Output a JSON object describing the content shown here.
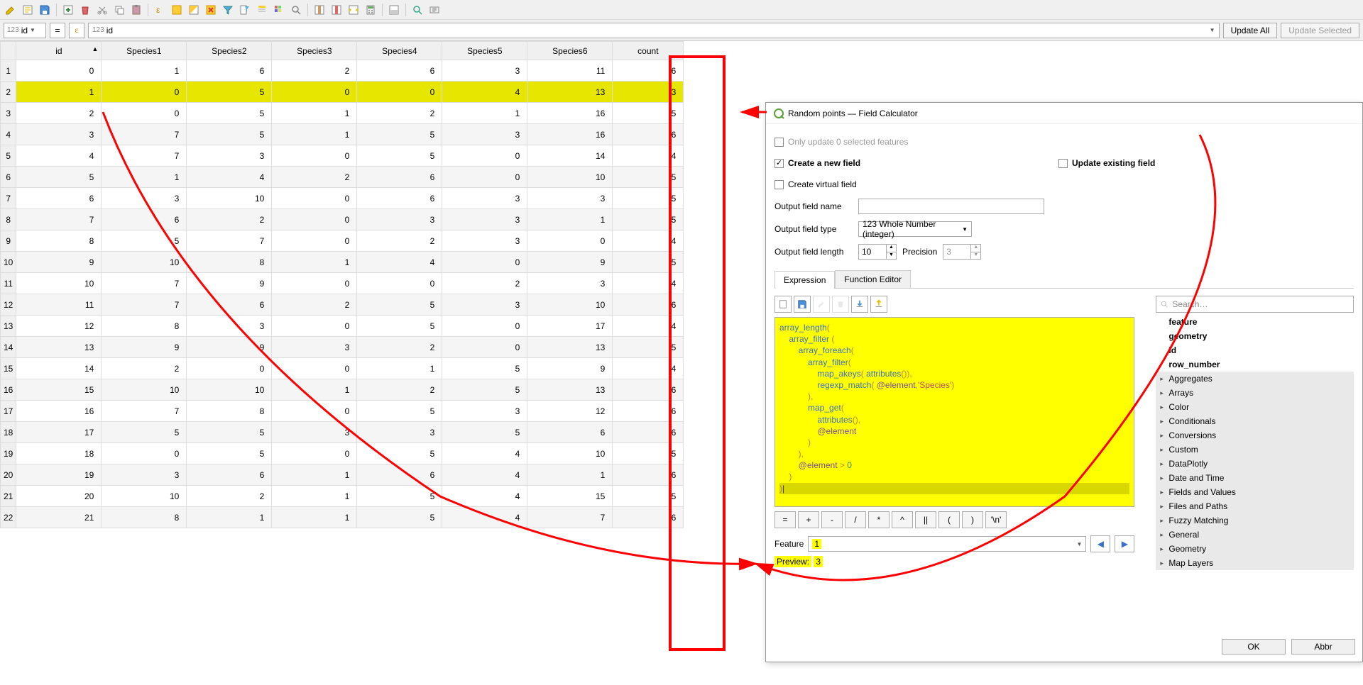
{
  "toolbar_icons": [
    "pencil",
    "edit-form",
    "save",
    "add-feature",
    "delete",
    "cut",
    "copy",
    "paste",
    "expression",
    "select-all",
    "invert",
    "deselect",
    "filter",
    "filter-form",
    "move-top",
    "dock",
    "zoom",
    "pan",
    "highlight",
    "layout",
    "calc",
    "zoom-to",
    "field-calc-open"
  ],
  "formula": {
    "field_type": "123",
    "field_name": "id",
    "eq": "=",
    "eps": "ε",
    "expr_field": "123",
    "expr_name": "id",
    "update_all": "Update All",
    "update_sel": "Update Selected"
  },
  "columns": [
    "id",
    "Species1",
    "Species2",
    "Species3",
    "Species4",
    "Species5",
    "Species6",
    "count"
  ],
  "rows": [
    {
      "n": 1,
      "hl": false,
      "v": [
        0,
        1,
        6,
        2,
        6,
        3,
        11,
        6
      ]
    },
    {
      "n": 2,
      "hl": true,
      "v": [
        1,
        0,
        5,
        0,
        0,
        4,
        13,
        3
      ]
    },
    {
      "n": 3,
      "hl": false,
      "v": [
        2,
        0,
        5,
        1,
        2,
        1,
        16,
        5
      ]
    },
    {
      "n": 4,
      "hl": false,
      "v": [
        3,
        7,
        5,
        1,
        5,
        3,
        16,
        6
      ]
    },
    {
      "n": 5,
      "hl": false,
      "v": [
        4,
        7,
        3,
        0,
        5,
        0,
        14,
        4
      ]
    },
    {
      "n": 6,
      "hl": false,
      "v": [
        5,
        1,
        4,
        2,
        6,
        0,
        10,
        5
      ]
    },
    {
      "n": 7,
      "hl": false,
      "v": [
        6,
        3,
        10,
        0,
        6,
        3,
        3,
        5
      ]
    },
    {
      "n": 8,
      "hl": false,
      "v": [
        7,
        6,
        2,
        0,
        3,
        3,
        1,
        5
      ]
    },
    {
      "n": 9,
      "hl": false,
      "v": [
        8,
        5,
        7,
        0,
        2,
        3,
        0,
        4
      ]
    },
    {
      "n": 10,
      "hl": false,
      "v": [
        9,
        10,
        8,
        1,
        4,
        0,
        9,
        5
      ]
    },
    {
      "n": 11,
      "hl": false,
      "v": [
        10,
        7,
        9,
        0,
        0,
        2,
        3,
        4
      ]
    },
    {
      "n": 12,
      "hl": false,
      "v": [
        11,
        7,
        6,
        2,
        5,
        3,
        10,
        6
      ]
    },
    {
      "n": 13,
      "hl": false,
      "v": [
        12,
        8,
        3,
        0,
        5,
        0,
        17,
        4
      ]
    },
    {
      "n": 14,
      "hl": false,
      "v": [
        13,
        9,
        9,
        3,
        2,
        0,
        13,
        5
      ]
    },
    {
      "n": 15,
      "hl": false,
      "v": [
        14,
        2,
        0,
        0,
        1,
        5,
        9,
        4
      ]
    },
    {
      "n": 16,
      "hl": false,
      "v": [
        15,
        10,
        10,
        1,
        2,
        5,
        13,
        6
      ]
    },
    {
      "n": 17,
      "hl": false,
      "v": [
        16,
        7,
        8,
        0,
        5,
        3,
        12,
        6
      ]
    },
    {
      "n": 18,
      "hl": false,
      "v": [
        17,
        5,
        5,
        3,
        3,
        5,
        6,
        6
      ]
    },
    {
      "n": 19,
      "hl": false,
      "v": [
        18,
        0,
        5,
        0,
        5,
        4,
        10,
        5
      ]
    },
    {
      "n": 20,
      "hl": false,
      "v": [
        19,
        3,
        6,
        1,
        6,
        4,
        1,
        6
      ]
    },
    {
      "n": 21,
      "hl": false,
      "v": [
        20,
        10,
        2,
        1,
        5,
        4,
        15,
        5
      ]
    },
    {
      "n": 22,
      "hl": false,
      "v": [
        21,
        8,
        1,
        1,
        5,
        4,
        7,
        6
      ]
    }
  ],
  "dialog": {
    "title": "Random points — Field Calculator",
    "only_update": "Only update 0 selected features",
    "create_new": "Create a new field",
    "update_existing": "Update existing field",
    "create_virtual": "Create virtual field",
    "out_name": "Output field name",
    "out_type": "Output field type",
    "out_type_val": "123 Whole Number (integer)",
    "out_len": "Output field length",
    "out_len_val": "10",
    "precision": "Precision",
    "precision_val": "3",
    "tab_expr": "Expression",
    "tab_func": "Function Editor",
    "feature_lbl": "Feature",
    "feature_val": "1",
    "preview_lbl": "Preview:",
    "preview_val": "3",
    "search_ph": "Search…",
    "operators": [
      "=",
      "+",
      "-",
      "/",
      "*",
      "^",
      "||",
      "(",
      ")",
      "'\\n'"
    ],
    "ok": "OK",
    "abbr": "Abbr"
  },
  "expression_lines": [
    {
      "indent": 0,
      "tokens": [
        {
          "t": "array_length",
          "c": "fn"
        },
        {
          "t": "(",
          "c": "cl-op"
        }
      ]
    },
    {
      "indent": 4,
      "tokens": [
        {
          "t": "array_filter",
          "c": "fn"
        },
        {
          "t": " (",
          "c": "cl-op"
        }
      ]
    },
    {
      "indent": 8,
      "tokens": [
        {
          "t": "array_foreach",
          "c": "fn"
        },
        {
          "t": "(",
          "c": "cl-op"
        }
      ]
    },
    {
      "indent": 12,
      "tokens": [
        {
          "t": "array_filter",
          "c": "fn"
        },
        {
          "t": "(",
          "c": "cl-op"
        }
      ]
    },
    {
      "indent": 16,
      "tokens": [
        {
          "t": "map_akeys",
          "c": "fn"
        },
        {
          "t": "( ",
          "c": "cl-op"
        },
        {
          "t": "attributes",
          "c": "fn"
        },
        {
          "t": "()),",
          "c": "cl-op"
        }
      ]
    },
    {
      "indent": 16,
      "tokens": [
        {
          "t": "regexp_match",
          "c": "fn"
        },
        {
          "t": "( ",
          "c": "cl-op"
        },
        {
          "t": "@element",
          "c": "cl-var"
        },
        {
          "t": ",",
          "c": "cl-op"
        },
        {
          "t": "'Species'",
          "c": "cl-str"
        },
        {
          "t": ")",
          "c": "cl-op"
        }
      ]
    },
    {
      "indent": 12,
      "tokens": [
        {
          "t": "),",
          "c": "cl-op"
        }
      ]
    },
    {
      "indent": 12,
      "tokens": [
        {
          "t": "map_get",
          "c": "fn"
        },
        {
          "t": "(",
          "c": "cl-op"
        }
      ]
    },
    {
      "indent": 16,
      "tokens": [
        {
          "t": "attributes",
          "c": "fn"
        },
        {
          "t": "(),",
          "c": "cl-op"
        }
      ]
    },
    {
      "indent": 16,
      "tokens": [
        {
          "t": "@element",
          "c": "cl-var"
        }
      ]
    },
    {
      "indent": 12,
      "tokens": [
        {
          "t": ")",
          "c": "cl-op"
        }
      ]
    },
    {
      "indent": 8,
      "tokens": [
        {
          "t": "),",
          "c": "cl-op"
        }
      ]
    },
    {
      "indent": 8,
      "tokens": [
        {
          "t": "@element",
          "c": "cl-var"
        },
        {
          "t": " > ",
          "c": "cl-op"
        },
        {
          "t": "0",
          "c": "cl-num"
        }
      ]
    },
    {
      "indent": 4,
      "tokens": [
        {
          "t": ")",
          "c": "cl-op"
        }
      ]
    },
    {
      "indent": 0,
      "tokens": [
        {
          "t": ")",
          "c": "cl-op"
        }
      ],
      "cursor": true
    }
  ],
  "tree": [
    {
      "label": "feature",
      "bold": true,
      "exp": false
    },
    {
      "label": "geometry",
      "bold": true,
      "exp": false
    },
    {
      "label": "id",
      "bold": true,
      "exp": false
    },
    {
      "label": "row_number",
      "bold": true,
      "exp": false
    },
    {
      "label": "Aggregates",
      "grp": true,
      "exp": true
    },
    {
      "label": "Arrays",
      "grp": true,
      "exp": true
    },
    {
      "label": "Color",
      "grp": true,
      "exp": true
    },
    {
      "label": "Conditionals",
      "grp": true,
      "exp": true
    },
    {
      "label": "Conversions",
      "grp": true,
      "exp": true
    },
    {
      "label": "Custom",
      "grp": true,
      "exp": true
    },
    {
      "label": "DataPlotly",
      "grp": true,
      "exp": true
    },
    {
      "label": "Date and Time",
      "grp": true,
      "exp": true
    },
    {
      "label": "Fields and Values",
      "grp": true,
      "exp": true
    },
    {
      "label": "Files and Paths",
      "grp": true,
      "exp": true
    },
    {
      "label": "Fuzzy Matching",
      "grp": true,
      "exp": true
    },
    {
      "label": "General",
      "grp": true,
      "exp": true
    },
    {
      "label": "Geometry",
      "grp": true,
      "exp": true
    },
    {
      "label": "Map Layers",
      "grp": true,
      "exp": true
    }
  ]
}
